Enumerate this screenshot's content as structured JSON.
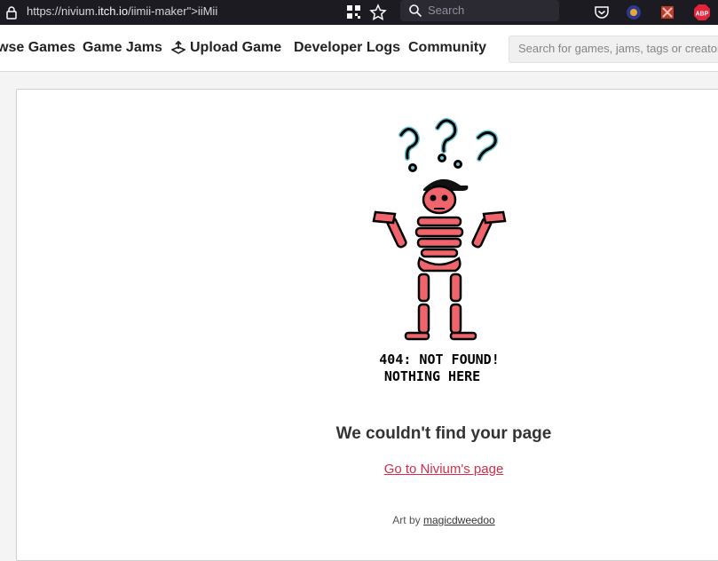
{
  "browser": {
    "url_prefix": "https://nivium.",
    "url_host": "itch.io",
    "url_suffix": "/iimii-maker\">iiMii",
    "search_placeholder": "Search"
  },
  "nav": {
    "items": [
      {
        "label": "wse Games"
      },
      {
        "label": "Game Jams"
      },
      {
        "label": "Upload Game"
      },
      {
        "label": "Developer Logs"
      },
      {
        "label": "Community"
      }
    ],
    "search_placeholder": "Search for games, jams, tags or creators"
  },
  "page": {
    "art_caption_line1": "404: NOT FOUND!",
    "art_caption_line2": "NOTHING HERE",
    "heading": "We couldn't find your page",
    "link": "Go to Nivium's page",
    "credit_prefix": "Art by",
    "credit_author": "magicdweedoo"
  },
  "colors": {
    "accent": "#da2c49",
    "skeleton": "#f0656b",
    "question": "#6cc5d0",
    "chrome_bg": "#1c1b22"
  }
}
